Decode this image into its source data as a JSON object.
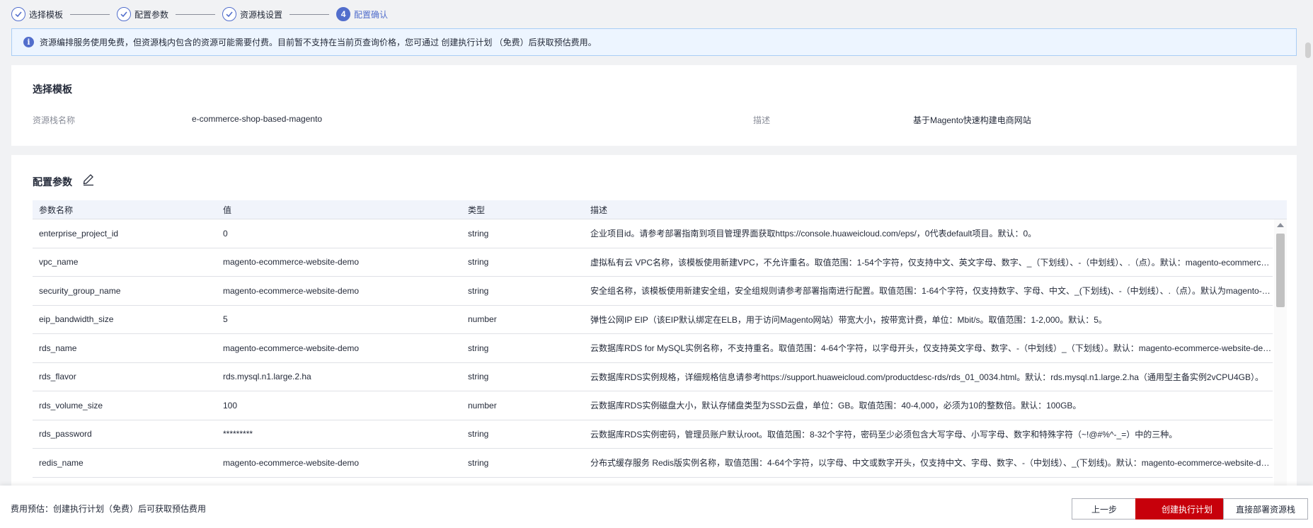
{
  "steps": [
    {
      "label": "选择模板",
      "status": "done"
    },
    {
      "label": "配置参数",
      "status": "done"
    },
    {
      "label": "资源栈设置",
      "status": "done"
    },
    {
      "label": "配置确认",
      "status": "active",
      "number": "4"
    }
  ],
  "banner": {
    "text": "资源编排服务使用免费，但资源栈内包含的资源可能需要付费。目前暂不支持在当前页查询价格，您可通过 创建执行计划 （免费）后获取预估费用。"
  },
  "template_section": {
    "title": "选择模板",
    "stack_name_label": "资源栈名称",
    "stack_name_value": "e-commerce-shop-based-magento",
    "description_label": "描述",
    "description_value": "基于Magento快速构建电商网站"
  },
  "params_section": {
    "title": "配置参数",
    "columns": [
      "参数名称",
      "值",
      "类型",
      "描述"
    ],
    "rows": [
      {
        "name": "enterprise_project_id",
        "value": "0",
        "type": "string",
        "desc": "企业项目id。请参考部署指南到项目管理界面获取https://console.huaweicloud.com/eps/，0代表default项目。默认：0。"
      },
      {
        "name": "vpc_name",
        "value": "magento-ecommerce-website-demo",
        "type": "string",
        "desc": "虚拟私有云 VPC名称，该模板使用新建VPC，不允许重名。取值范围：1-54个字符，仅支持中文、英文字母、数字、_（下划线）、-（中划线）、.（点）。默认：magento-ecommerce-website-demo。"
      },
      {
        "name": "security_group_name",
        "value": "magento-ecommerce-website-demo",
        "type": "string",
        "desc": "安全组名称，该模板使用新建安全组，安全组规则请参考部署指南进行配置。取值范围：1-64个字符，仅支持数字、字母、中文、_(下划线)、-（中划线）、.（点）。默认为magento-ecommerce-website-demo。"
      },
      {
        "name": "eip_bandwidth_size",
        "value": "5",
        "type": "number",
        "desc": "弹性公网IP EIP（该EIP默认绑定在ELB，用于访问Magento网站）带宽大小，按带宽计费，单位：Mbit/s。取值范围：1-2,000。默认：5。"
      },
      {
        "name": "rds_name",
        "value": "magento-ecommerce-website-demo",
        "type": "string",
        "desc": "云数据库RDS for MySQL实例名称，不支持重名。取值范围：4-64个字符，以字母开头，仅支持英文字母、数字、-（中划线）_（下划线）。默认：magento-ecommerce-website-demo。"
      },
      {
        "name": "rds_flavor",
        "value": "rds.mysql.n1.large.2.ha",
        "type": "string",
        "desc": "云数据库RDS实例规格，详细规格信息请参考https://support.huaweicloud.com/productdesc-rds/rds_01_0034.html。默认：rds.mysql.n1.large.2.ha（通用型主备实例2vCPU4GB）。"
      },
      {
        "name": "rds_volume_size",
        "value": "100",
        "type": "number",
        "desc": "云数据库RDS实例磁盘大小，默认存储盘类型为SSD云盘，单位：GB。取值范围：40-4,000，必须为10的整数倍。默认：100GB。"
      },
      {
        "name": "rds_password",
        "value": "*********",
        "type": "string",
        "desc": "云数据库RDS实例密码，管理员账户默认root。取值范围：8-32个字符，密码至少必须包含大写字母、小写字母、数字和特殊字符（~!@#%^-_=）中的三种。"
      },
      {
        "name": "redis_name",
        "value": "magento-ecommerce-website-demo",
        "type": "string",
        "desc": "分布式缓存服务 Redis版实例名称，取值范围：4-64个字符，以字母、中文或数字开头，仅支持中文、字母、数字、-（中划线）、_(下划线)。默认：magento-ecommerce-website-demo。"
      }
    ]
  },
  "footer": {
    "cost_text": "费用预估：创建执行计划（免费）后可获取预估费用",
    "prev_label": "上一步",
    "create_plan_label": "创建执行计划",
    "deploy_label": "直接部署资源栈"
  },
  "colors": {
    "accent": "#526ecc",
    "primary_button": "#c7000b",
    "banner_bg": "#edf5ff"
  }
}
